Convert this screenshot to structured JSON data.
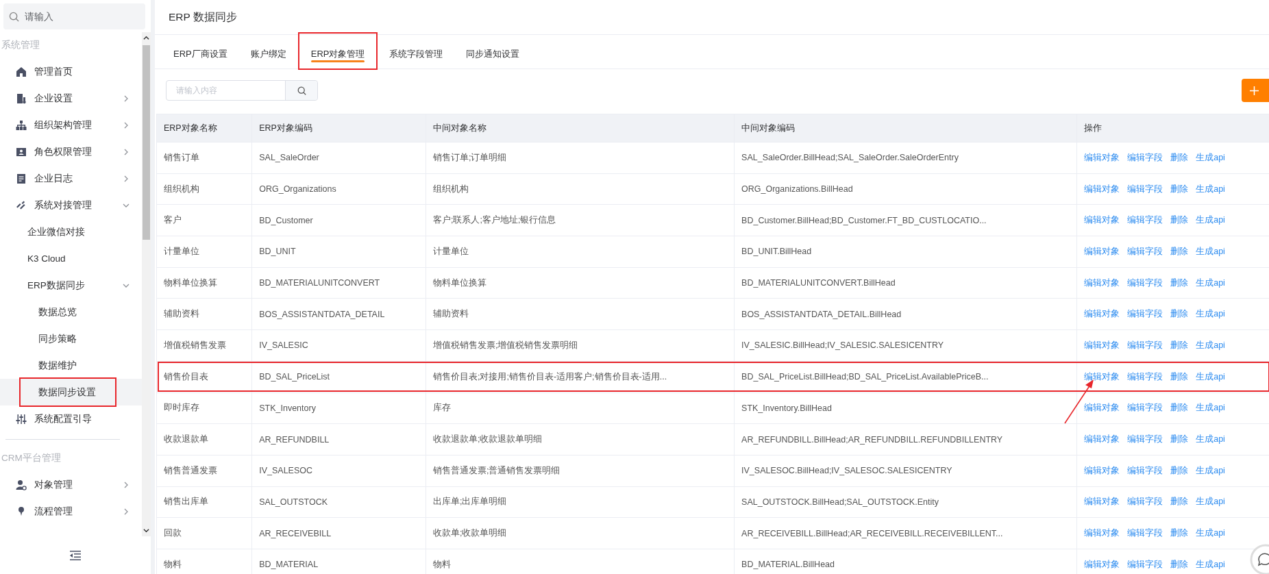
{
  "sidebar": {
    "search": {
      "placeholder": "请输入"
    },
    "sections": [
      {
        "title": "系统管理",
        "items": [
          {
            "label": "管理首页",
            "kind": "home",
            "selected": false
          },
          {
            "label": "企业设置",
            "kind": "building",
            "expanded": false
          },
          {
            "label": "组织架构管理",
            "kind": "org",
            "expanded": false
          },
          {
            "label": "角色权限管理",
            "kind": "card",
            "expanded": false
          },
          {
            "label": "企业日志",
            "kind": "doc",
            "expanded": false
          },
          {
            "label": "系统对接管理",
            "kind": "link",
            "expanded": true,
            "children": [
              {
                "label": "企业微信对接",
                "selected": false
              },
              {
                "label": "K3 Cloud",
                "selected": false
              },
              {
                "label": "ERP数据同步",
                "expanded": true,
                "children": [
                  {
                    "label": "数据总览",
                    "selected": false
                  },
                  {
                    "label": "同步策略",
                    "selected": false
                  },
                  {
                    "label": "数据维护",
                    "selected": false
                  },
                  {
                    "label": "数据同步设置",
                    "selected": true,
                    "highlighted": true
                  }
                ]
              }
            ]
          },
          {
            "label": "系统配置引导",
            "kind": "sliders",
            "selected": false
          }
        ]
      },
      {
        "title": "CRM平台管理",
        "items": [
          {
            "label": "对象管理",
            "kind": "usergear",
            "expanded": false
          },
          {
            "label": "流程管理",
            "kind": "pin",
            "expanded": false
          }
        ]
      }
    ]
  },
  "main": {
    "title": "ERP 数据同步",
    "tabs": [
      {
        "label": "ERP厂商设置",
        "selected": false,
        "highlighted": false
      },
      {
        "label": "账户绑定",
        "selected": false,
        "highlighted": false
      },
      {
        "label": "ERP对象管理",
        "selected": true,
        "highlighted": true
      },
      {
        "label": "系统字段管理",
        "selected": false,
        "highlighted": false
      },
      {
        "label": "同步通知设置",
        "selected": false,
        "highlighted": false
      }
    ],
    "search": {
      "placeholder": "请输入内容"
    },
    "table": {
      "columns": [
        "ERP对象名称",
        "ERP对象编码",
        "中间对象名称",
        "中间对象编码",
        "操作"
      ],
      "rows": [
        {
          "cells": [
            "销售订单",
            "SAL_SaleOrder",
            "销售订单;订单明细",
            "SAL_SaleOrder.BillHead;SAL_SaleOrder.SaleOrderEntry"
          ],
          "actions": [
            "编辑对象",
            "编辑字段",
            "删除",
            "生成api"
          ],
          "highlighted": false
        },
        {
          "cells": [
            "组织机构",
            "ORG_Organizations",
            "组织机构",
            "ORG_Organizations.BillHead"
          ],
          "actions": [
            "编辑对象",
            "编辑字段",
            "删除",
            "生成api"
          ],
          "highlighted": false
        },
        {
          "cells": [
            "客户",
            "BD_Customer",
            "客户;联系人;客户地址;银行信息",
            "BD_Customer.BillHead;BD_Customer.FT_BD_CUSTLOCATIO..."
          ],
          "actions": [
            "编辑对象",
            "编辑字段",
            "删除",
            "生成api"
          ],
          "highlighted": false
        },
        {
          "cells": [
            "计量单位",
            "BD_UNIT",
            "计量单位",
            "BD_UNIT.BillHead"
          ],
          "actions": [
            "编辑对象",
            "编辑字段",
            "删除",
            "生成api"
          ],
          "highlighted": false
        },
        {
          "cells": [
            "物料单位换算",
            "BD_MATERIALUNITCONVERT",
            "物料单位换算",
            "BD_MATERIALUNITCONVERT.BillHead"
          ],
          "actions": [
            "编辑对象",
            "编辑字段",
            "删除",
            "生成api"
          ],
          "highlighted": false
        },
        {
          "cells": [
            "辅助资料",
            "BOS_ASSISTANTDATA_DETAIL",
            "辅助资料",
            "BOS_ASSISTANTDATA_DETAIL.BillHead"
          ],
          "actions": [
            "编辑对象",
            "编辑字段",
            "删除",
            "生成api"
          ],
          "highlighted": false
        },
        {
          "cells": [
            "增值税销售发票",
            "IV_SALESIC",
            "增值税销售发票;增值税销售发票明细",
            "IV_SALESIC.BillHead;IV_SALESIC.SALESICENTRY"
          ],
          "actions": [
            "编辑对象",
            "编辑字段",
            "删除",
            "生成api"
          ],
          "highlighted": false
        },
        {
          "cells": [
            "销售价目表",
            "BD_SAL_PriceList",
            "销售价目表;对接用;销售价目表-适用客户;销售价目表-适用...",
            "BD_SAL_PriceList.BillHead;BD_SAL_PriceList.AvailablePriceB..."
          ],
          "actions": [
            "编辑对象",
            "编辑字段",
            "删除",
            "生成api"
          ],
          "highlighted": true
        },
        {
          "cells": [
            "即时库存",
            "STK_Inventory",
            "库存",
            "STK_Inventory.BillHead"
          ],
          "actions": [
            "编辑对象",
            "编辑字段",
            "删除",
            "生成api"
          ],
          "highlighted": false
        },
        {
          "cells": [
            "收款退款单",
            "AR_REFUNDBILL",
            "收款退款单;收款退款单明细",
            "AR_REFUNDBILL.BillHead;AR_REFUNDBILL.REFUNDBILLENTRY"
          ],
          "actions": [
            "编辑对象",
            "编辑字段",
            "删除",
            "生成api"
          ],
          "highlighted": false
        },
        {
          "cells": [
            "销售普通发票",
            "IV_SALESOC",
            "销售普通发票;普通销售发票明细",
            "IV_SALESOC.BillHead;IV_SALESOC.SALESICENTRY"
          ],
          "actions": [
            "编辑对象",
            "编辑字段",
            "删除",
            "生成api"
          ],
          "highlighted": false
        },
        {
          "cells": [
            "销售出库单",
            "SAL_OUTSTOCK",
            "出库单;出库单明细",
            "SAL_OUTSTOCK.BillHead;SAL_OUTSTOCK.Entity"
          ],
          "actions": [
            "编辑对象",
            "编辑字段",
            "删除",
            "生成api"
          ],
          "highlighted": false
        },
        {
          "cells": [
            "回款",
            "AR_RECEIVEBILL",
            "收款单;收款单明细",
            "AR_RECEIVEBILL.BillHead;AR_RECEIVEBILL.RECEIVEBILLENT..."
          ],
          "actions": [
            "编辑对象",
            "编辑字段",
            "删除",
            "生成api"
          ],
          "highlighted": false
        },
        {
          "cells": [
            "物料",
            "BD_MATERIAL",
            "物料",
            "BD_MATERIAL.BillHead"
          ],
          "actions": [
            "编辑对象",
            "编辑字段",
            "删除",
            "生成api"
          ],
          "highlighted": false
        }
      ]
    }
  }
}
